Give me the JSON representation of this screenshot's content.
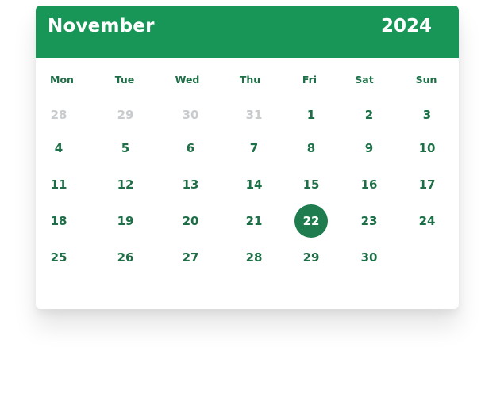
{
  "header": {
    "month": "November",
    "year": "2024"
  },
  "weekdays": [
    "Mon",
    "Tue",
    "Wed",
    "Thu",
    "Fri",
    "Sat",
    "Sun"
  ],
  "weeks": [
    [
      "28",
      "29",
      "30",
      "31",
      "1",
      "2",
      "3"
    ],
    [
      "4",
      "5",
      "6",
      "7",
      "8",
      "9",
      "10"
    ],
    [
      "11",
      "12",
      "13",
      "14",
      "15",
      "16",
      "17"
    ],
    [
      "18",
      "19",
      "20",
      "21",
      "22",
      "23",
      "24"
    ],
    [
      "25",
      "26",
      "27",
      "28",
      "29",
      "30",
      ""
    ]
  ],
  "muted_days": [
    [
      0,
      0
    ],
    [
      0,
      1
    ],
    [
      0,
      2
    ],
    [
      0,
      3
    ]
  ],
  "selected_day": [
    3,
    4
  ],
  "colors": {
    "header_bg": "#179657",
    "day_text": "#1e6f47",
    "muted_text": "#c9cccf",
    "selected_bg": "#1e7c4e",
    "selected_text": "#ffffff"
  }
}
